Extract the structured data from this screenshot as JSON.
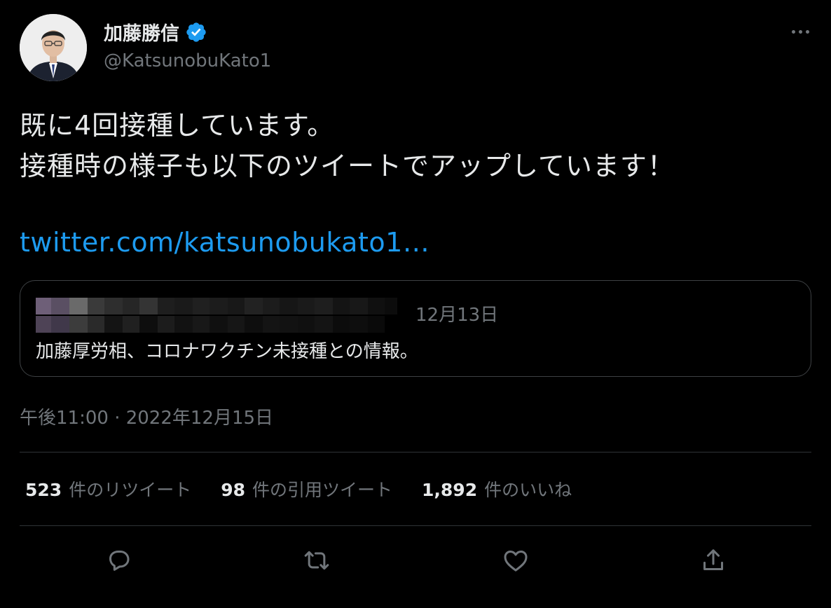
{
  "author": {
    "display_name": "加藤勝信",
    "handle": "@KatsunobuKato1",
    "avatar_icon": "profile-photo"
  },
  "tweet": {
    "line1": "既に4回接種しています。",
    "line2": "接種時の様子も以下のツイートでアップしています！",
    "link": "twitter.com/katsunobukato1…",
    "timestamp": "午後11:00 · 2022年12月15日"
  },
  "quote": {
    "date": "12月13日",
    "text": "加藤厚労相、コロナワクチン未接種との情報。"
  },
  "stats": {
    "retweets": {
      "count": "523",
      "label": "件のリツイート"
    },
    "quotes": {
      "count": "98",
      "label": "件の引用ツイート"
    },
    "likes": {
      "count": "1,892",
      "label": "件のいいね"
    }
  },
  "actions": [
    "reply-icon",
    "retweet-icon",
    "like-icon",
    "share-icon"
  ],
  "colors": {
    "background": "#000000",
    "text": "#e7e9ea",
    "secondary": "#71767b",
    "link": "#1d9bf0",
    "verified": "#1d9bf0",
    "divider": "#2f3336"
  }
}
